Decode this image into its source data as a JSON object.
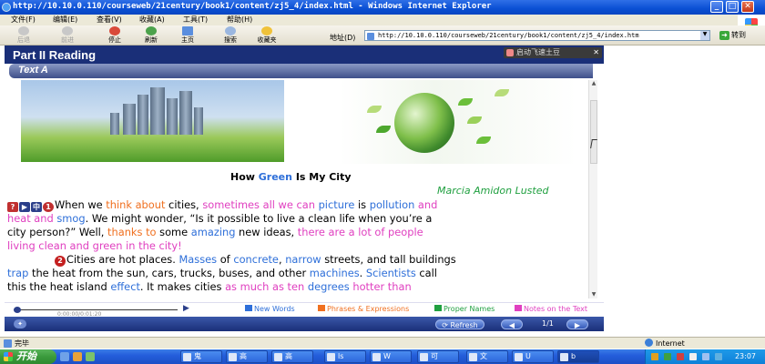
{
  "window": {
    "title": "http://10.10.0.110/courseweb/21century/book1/content/zj5_4/index.html - Windows Internet Explorer"
  },
  "menu": {
    "items": [
      "文件(F)",
      "编辑(E)",
      "查看(V)",
      "收藏(A)",
      "工具(T)",
      "帮助(H)"
    ]
  },
  "toolbar": {
    "buttons": [
      "后退",
      "前进",
      "停止",
      "刷新",
      "主页",
      "搜索",
      "收藏夹"
    ],
    "address_label": "地址(D)",
    "address_value": "http://10.10.0.110/courseweb/21century/book1/content/zj5_4/index.htm",
    "go_label": "转到"
  },
  "page": {
    "part_title": "Part II Reading",
    "section_title": "Text A",
    "launcher_label": "启动飞速土豆"
  },
  "story": {
    "title_pre": "How ",
    "title_green": "Green",
    "title_post": " Is My City",
    "author": "Marcia Amidon Lusted",
    "para_number": "2"
  },
  "paragraph1": {
    "l1_a": "When we ",
    "l1_b": "think about",
    "l1_c": " cities, ",
    "l1_d": "sometimes all we can",
    "l1_e": " ",
    "l1_f": "picture",
    "l1_g": " is ",
    "l1_h": "pollution",
    "l1_i": " and",
    "l2_a": "heat and",
    "l2_b": " ",
    "l2_c": "smog",
    "l2_d": ". We might wonder, “Is it possible to live a clean life when you’re a",
    "l3_a": "city person?” Well, ",
    "l3_b": "thanks to",
    "l3_c": " some ",
    "l3_d": "amazing",
    "l3_e": " new ideas, ",
    "l3_f": "there are a lot of people",
    "l4_a": "living clean and green in the city!"
  },
  "paragraph2": {
    "l1_a": "Cities are hot places. ",
    "l1_b": "Masses",
    "l1_c": " of ",
    "l1_d": "concrete",
    "l1_e": ", ",
    "l1_f": "narrow",
    "l1_g": " streets, and tall buildings",
    "l2_a": "trap",
    "l2_b": " the heat from the sun, cars, trucks, buses, and other ",
    "l2_c": "machines",
    "l2_d": ". ",
    "l2_e": "Scientists",
    "l2_f": " call",
    "l3_a": "this the heat island ",
    "l3_b": "effect",
    "l3_c": ". It makes cities ",
    "l3_d": "as much as ten",
    "l3_e": " ",
    "l3_f": "degrees",
    "l3_g": " ",
    "l3_h": "hotter than"
  },
  "player": {
    "timecode": "0:00:00/0:01:20"
  },
  "legend": {
    "new_words": "New Words",
    "phrases": "Phrases & Expressions",
    "proper_names": "Proper Names",
    "notes": "Notes on the Text"
  },
  "nav": {
    "refresh_label": "Refresh",
    "page_indicator": "1/1"
  },
  "status": {
    "left_text": "完毕",
    "zone_text": "Internet"
  },
  "taskbar": {
    "start_label": "开始",
    "tasks": [
      "鬼",
      "高",
      "高",
      "ls",
      "W",
      "可",
      "文",
      "U",
      "b"
    ],
    "clock": "23:07"
  },
  "colors": {
    "new_words": "#2e6fd9",
    "phrases": "#f07020",
    "proper_names": "#20a040",
    "notes": "#e040c0",
    "page_header": "#1a2f78"
  }
}
